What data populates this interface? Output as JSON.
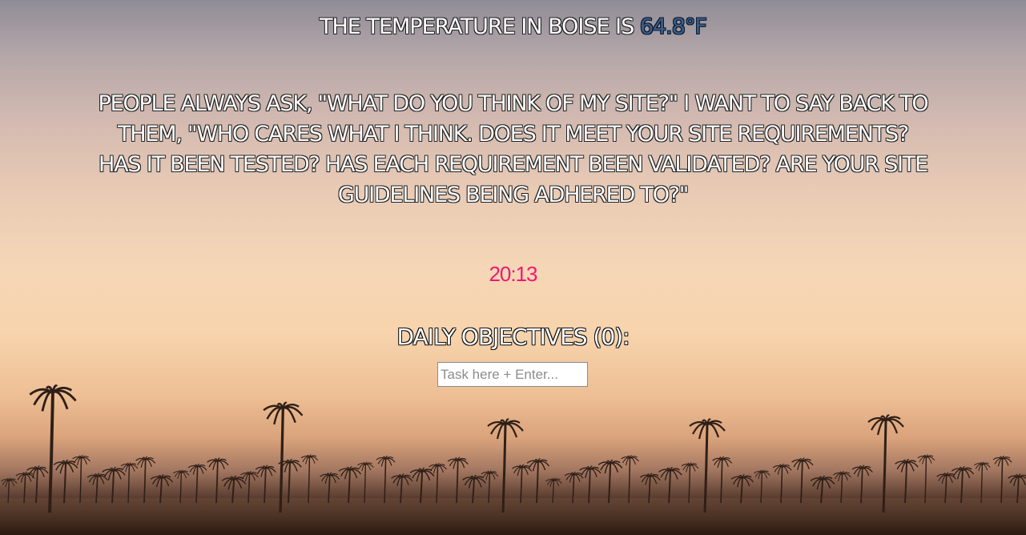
{
  "weather": {
    "prefix": "The temperature in Boise is ",
    "value": "64.8°F"
  },
  "quote": {
    "text": "People always ask, \"What do you think of my site?\" I want to say back to them, \"Who cares what I think. Does it meet your site requirements? Has it been tested? Has each requirement been validated? Are your site guidelines being adhered to?\""
  },
  "clock": {
    "time": "20:13"
  },
  "objectives": {
    "title": "Daily Objectives (0):",
    "input_placeholder": "Task here + Enter..."
  },
  "colors": {
    "clock": "#ee1a72",
    "temperature_value": "#3a5f88",
    "heading_text": "#ffffff"
  },
  "background": {
    "scene": "palm-trees-sunset-image"
  }
}
